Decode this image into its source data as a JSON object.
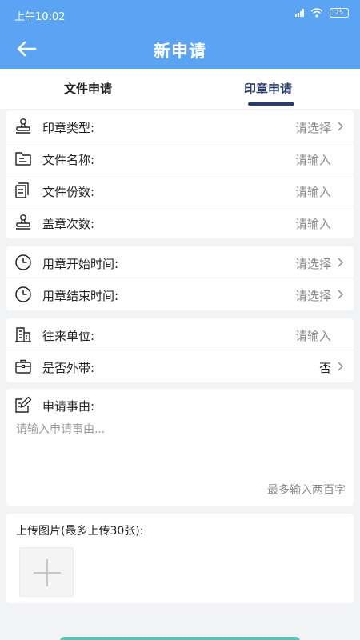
{
  "status_bar": {
    "time": "上午10:02",
    "battery": "25"
  },
  "header": {
    "title": "新申请",
    "back_icon": "arrow-left-icon"
  },
  "tabs": [
    {
      "label": "文件申请",
      "active": false
    },
    {
      "label": "印章申请",
      "active": true
    }
  ],
  "form": {
    "groups": [
      [
        {
          "label": "印章类型:",
          "value": "请选择",
          "icon": "stamp-icon",
          "chevron": true
        },
        {
          "label": "文件名称:",
          "value": "请输入",
          "icon": "folder-icon",
          "chevron": false
        },
        {
          "label": "文件份数:",
          "value": "请输入",
          "icon": "copies-icon",
          "chevron": false
        },
        {
          "label": "盖章次数:",
          "value": "请输入",
          "icon": "stamp-icon",
          "chevron": false
        }
      ],
      [
        {
          "label": "用章开始时间:",
          "value": "请选择",
          "icon": "clock-icon",
          "chevron": true
        },
        {
          "label": "用章结束时间:",
          "value": "请选择",
          "icon": "clock-icon",
          "chevron": true
        }
      ],
      [
        {
          "label": "往来单位:",
          "value": "请输入",
          "icon": "building-icon",
          "chevron": false
        },
        {
          "label": "是否外带:",
          "value": "否",
          "icon": "briefcase-icon",
          "chevron": true
        }
      ]
    ],
    "reason": {
      "label": "申请事由:",
      "placeholder": "请输入申请事由...",
      "limit": "最多输入两百字",
      "icon": "edit-icon"
    },
    "upload": {
      "label": "上传图片(最多上传30张):",
      "add_icon": "plus-icon"
    }
  },
  "colors": {
    "primary": "#5ba3f3",
    "tab_active": "#2b3d6b",
    "submit": "#5fc0b5"
  }
}
